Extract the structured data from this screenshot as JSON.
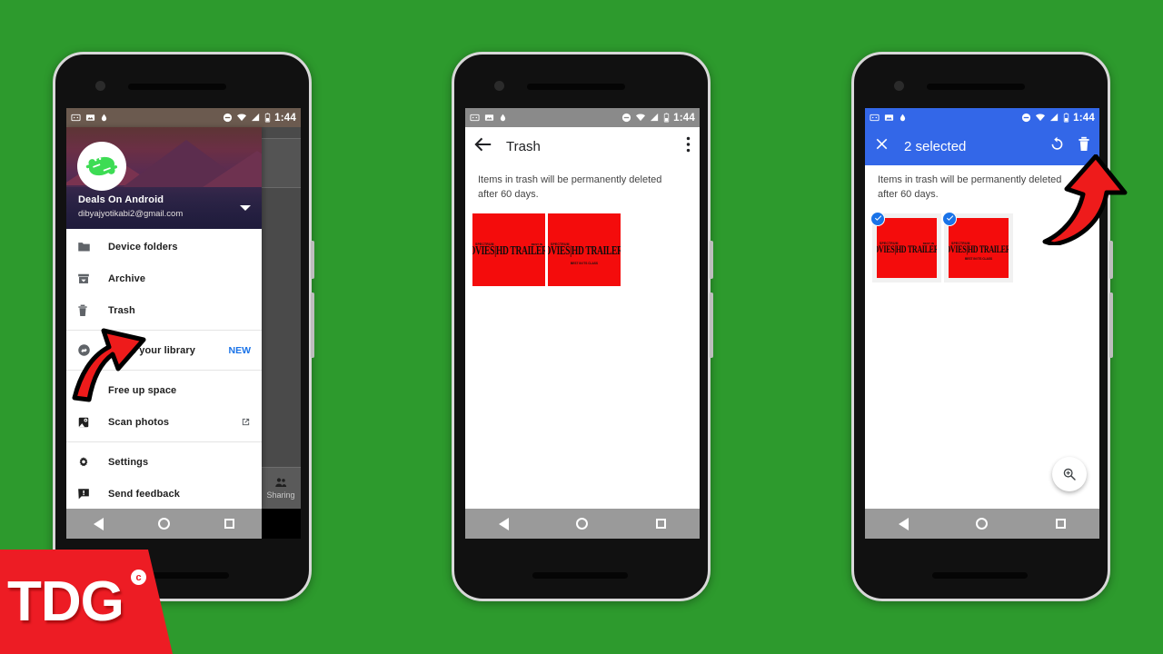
{
  "background_color": "#2d9a2d",
  "status_bar": {
    "time": "1:44",
    "icons": [
      "screenshot-icon",
      "image-icon",
      "droplet-icon",
      "do-not-disturb-icon",
      "wifi-icon",
      "signal-icon",
      "battery-icon"
    ]
  },
  "phone1": {
    "account": {
      "name": "Deals On Android",
      "email": "dibyajyotikabi2@gmail.com"
    },
    "menu": [
      {
        "label": "Device folders",
        "icon": "folder-icon",
        "badge": "",
        "trailing": ""
      },
      {
        "label": "Archive",
        "icon": "archive-icon",
        "badge": "",
        "trailing": ""
      },
      {
        "label": "Trash",
        "icon": "trash-icon",
        "badge": "",
        "trailing": ""
      },
      {
        "label": "Share your library",
        "icon": "share-library-icon",
        "badge": "NEW",
        "trailing": ""
      },
      {
        "label": "Free up space",
        "icon": "free-up-space-icon",
        "badge": "",
        "trailing": ""
      },
      {
        "label": "Scan photos",
        "icon": "scan-photos-icon",
        "badge": "",
        "trailing": "external-link-icon"
      },
      {
        "label": "Settings",
        "icon": "gear-icon",
        "badge": "",
        "trailing": ""
      },
      {
        "label": "Send feedback",
        "icon": "feedback-icon",
        "badge": "",
        "trailing": ""
      }
    ],
    "background_tab": {
      "label": "Sharing",
      "icon": "people-icon"
    }
  },
  "phone2": {
    "appbar": {
      "title": "Trash",
      "back_icon": "back-arrow-icon",
      "overflow_icon": "more-vert-icon"
    },
    "note": "Items in trash will be permanently deleted after 60 days.",
    "thumbnails": [
      {
        "top_left": "SPECTRUM",
        "top_right": "BEST IN",
        "main": "OVIES|HD TRAILERS|MOVIE RA",
        "sub": ""
      },
      {
        "top_left": "SPECTRUM",
        "top_right": "",
        "main": "OVIES|HD TRAILERS|MOVIE RA",
        "sub": "BEST IN ITS CLASS"
      }
    ]
  },
  "phone3": {
    "appbar": {
      "title": "2 selected",
      "close_icon": "close-icon",
      "restore_icon": "restore-icon",
      "delete_icon": "trash-icon",
      "accent_color": "#3367e8"
    },
    "note": "Items in trash will be permanently deleted after 60 days.",
    "thumbnails": [
      {
        "top_left": "SPECTRUM",
        "top_right": "BEST IN",
        "main": "OVIES|HD TRAILERS|MOVIE RA",
        "sub": "",
        "selected": true
      },
      {
        "top_left": "SPECTRUM",
        "top_right": "",
        "main": "OVIES|HD TRAILERS|MOVIE RA",
        "sub": "BEST IN ITS CLASS",
        "selected": true
      }
    ],
    "fab": {
      "icon": "search-zoom-icon"
    }
  },
  "nav_bar": {
    "back": "back-triangle-icon",
    "home": "home-circle-icon",
    "recents": "recents-square-icon"
  },
  "watermark": {
    "text": "TDG",
    "copyright": "c",
    "color": "#ed1c24"
  }
}
